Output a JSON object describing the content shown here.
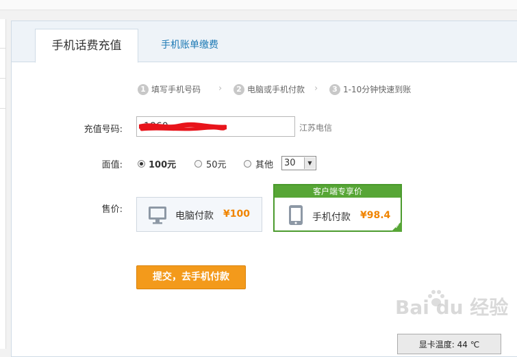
{
  "tabs": [
    {
      "label": "手机话费充值",
      "active": true
    },
    {
      "label": "手机账单缴费",
      "active": false
    }
  ],
  "steps": [
    {
      "num": "1",
      "label": "填写手机号码"
    },
    {
      "num": "2",
      "label": "电脑或手机付款"
    },
    {
      "num": "3",
      "label": "1-10分钟快速到账"
    }
  ],
  "form": {
    "phone_label": "充值号码:",
    "phone_value": "1860",
    "carrier": "江苏电信",
    "amount_label": "面值:",
    "amount_options": [
      "100元",
      "50元",
      "其他"
    ],
    "amount_selected": "100元",
    "other_select_value": "30",
    "price_label": "售价:"
  },
  "payment": {
    "pc": {
      "label": "电脑付款",
      "price": "¥100"
    },
    "mobile": {
      "banner": "客户端专享价",
      "label": "手机付款",
      "price": "¥98.4"
    }
  },
  "submit_label": "提交，去手机付款",
  "watermark": "Bai du 经验",
  "gpu_temp": "显卡温度: 44 ℃",
  "colors": {
    "accent": "#f39a1b",
    "price": "#f08400",
    "green": "#57a636",
    "link": "#1e7ab5"
  }
}
